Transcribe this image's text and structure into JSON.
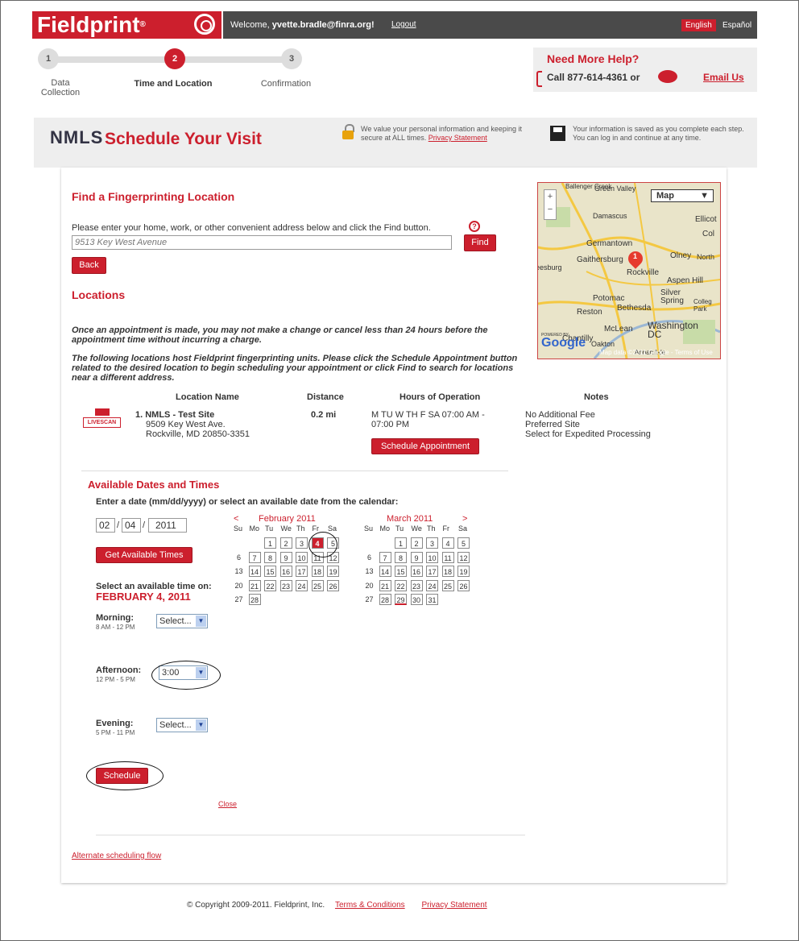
{
  "header": {
    "logo": "Fieldprint",
    "welcome_prefix": "Welcome,",
    "user_email": "yvette.bradle@finra.org!",
    "logout": "Logout",
    "lang_english": "English",
    "lang_spanish": "Español"
  },
  "steps": [
    {
      "num": "1",
      "label_line1": "Data",
      "label_line2": "Collection"
    },
    {
      "num": "2",
      "label_line1": "Time and Location",
      "label_line2": ""
    },
    {
      "num": "3",
      "label_line1": "Confirmation",
      "label_line2": ""
    }
  ],
  "help": {
    "title": "Need More Help?",
    "phone": "Call 877-614-4361 or",
    "email": "Email Us"
  },
  "banner": {
    "brand": "NMLS",
    "title": "Schedule Your Visit",
    "security_text": "We value your personal information and keeping it secure at ALL times.",
    "privacy_link": "Privacy Statement",
    "save_text": "Your information is saved as you complete each step. You can log in and continue at any time."
  },
  "find": {
    "heading": "Find a Fingerprinting Location",
    "instructions": "Please enter your home, work, or other convenient address below and click the Find button.",
    "address_value": "9513 Key West Avenue",
    "find_button": "Find",
    "back_button": "Back",
    "help_icon": "?"
  },
  "locations": {
    "heading": "Locations",
    "warning": "Once an appointment is made, you may not make a change or cancel less than 24 hours before the appointment time without incurring a charge.",
    "info": "The following locations host Fieldprint fingerprinting units. Please click the Schedule Appointment button related to the desired location to begin scheduling your appointment or click Find to search for locations near a different address.",
    "columns": [
      "Location Name",
      "Distance",
      "Hours of Operation",
      "Notes"
    ],
    "livescan_label": "LIVESCAN",
    "row": {
      "name": "1. NMLS - Test Site",
      "street": "9509 Key West Ave.",
      "city": "Rockville, MD 20850-3351",
      "distance": "0.2 mi",
      "hours": "M TU W TH F SA 07:00 AM - 07:00 PM",
      "schedule_button": "Schedule Appointment",
      "notes": [
        "No Additional Fee",
        "Preferred Site",
        "Select for Expedited Processing"
      ]
    }
  },
  "map": {
    "type_select": "Map",
    "places": [
      "Ballenger Creek",
      "Green Valley",
      "Damascus",
      "Ellicot",
      "Col",
      "Germantown",
      "Olney",
      "North",
      "Gaithersburg",
      "Leesburg",
      "Rockville",
      "Aspen Hill",
      "Potomac",
      "Silver Spring",
      "Colleg Park",
      "Reston",
      "Bethesda",
      "McLean",
      "Washington DC",
      "Chantilly",
      "Oakton",
      "Annandale"
    ],
    "marker": "1",
    "powered_by": "POWERED BY",
    "google": "Google",
    "copyright": "Map data ©2011 Google - Terms of Use"
  },
  "available": {
    "heading": "Available Dates and Times",
    "date_prompt": "Enter a date (mm/dd/yyyy) or select an available date from the calendar:",
    "month": "02",
    "day": "04",
    "year": "2011",
    "get_times_button": "Get Available Times",
    "select_prompt": "Select an available time on:",
    "selected_date": "FEBRUARY 4, 2011",
    "morning_label": "Morning:",
    "morning_range": "8 AM - 12 PM",
    "morning_value": "Select...",
    "afternoon_label": "Afternoon:",
    "afternoon_range": "12 PM - 5 PM",
    "afternoon_value": "3:00",
    "evening_label": "Evening:",
    "evening_range": "5 PM - 11 PM",
    "evening_value": "Select...",
    "schedule_button": "Schedule",
    "close_link": "Close",
    "prev": "<",
    "next": ">",
    "weekdays": [
      "Su",
      "Mo",
      "Tu",
      "We",
      "Th",
      "Fr",
      "Sa"
    ],
    "cal1": {
      "title": "February 2011",
      "rows": [
        [
          "",
          "",
          "1",
          "2",
          "3",
          "4",
          "5"
        ],
        [
          "6",
          "7",
          "8",
          "9",
          "10",
          "11",
          "12"
        ],
        [
          "13",
          "14",
          "15",
          "16",
          "17",
          "18",
          "19"
        ],
        [
          "20",
          "21",
          "22",
          "23",
          "24",
          "25",
          "26"
        ],
        [
          "27",
          "28",
          "",
          "",
          "",
          "",
          ""
        ]
      ],
      "selected": "4"
    },
    "cal2": {
      "title": "March 2011",
      "rows": [
        [
          "",
          "",
          "1",
          "2",
          "3",
          "4",
          "5"
        ],
        [
          "6",
          "7",
          "8",
          "9",
          "10",
          "11",
          "12"
        ],
        [
          "13",
          "14",
          "15",
          "16",
          "17",
          "18",
          "19"
        ],
        [
          "20",
          "21",
          "22",
          "23",
          "24",
          "25",
          "26"
        ],
        [
          "27",
          "28",
          "29",
          "30",
          "31",
          "",
          ""
        ]
      ],
      "underlined": "29"
    }
  },
  "alt_link": "Alternate scheduling flow",
  "footer": {
    "copyright": "© Copyright 2009-2011. Fieldprint, Inc.",
    "terms": "Terms & Conditions",
    "privacy": "Privacy Statement"
  }
}
